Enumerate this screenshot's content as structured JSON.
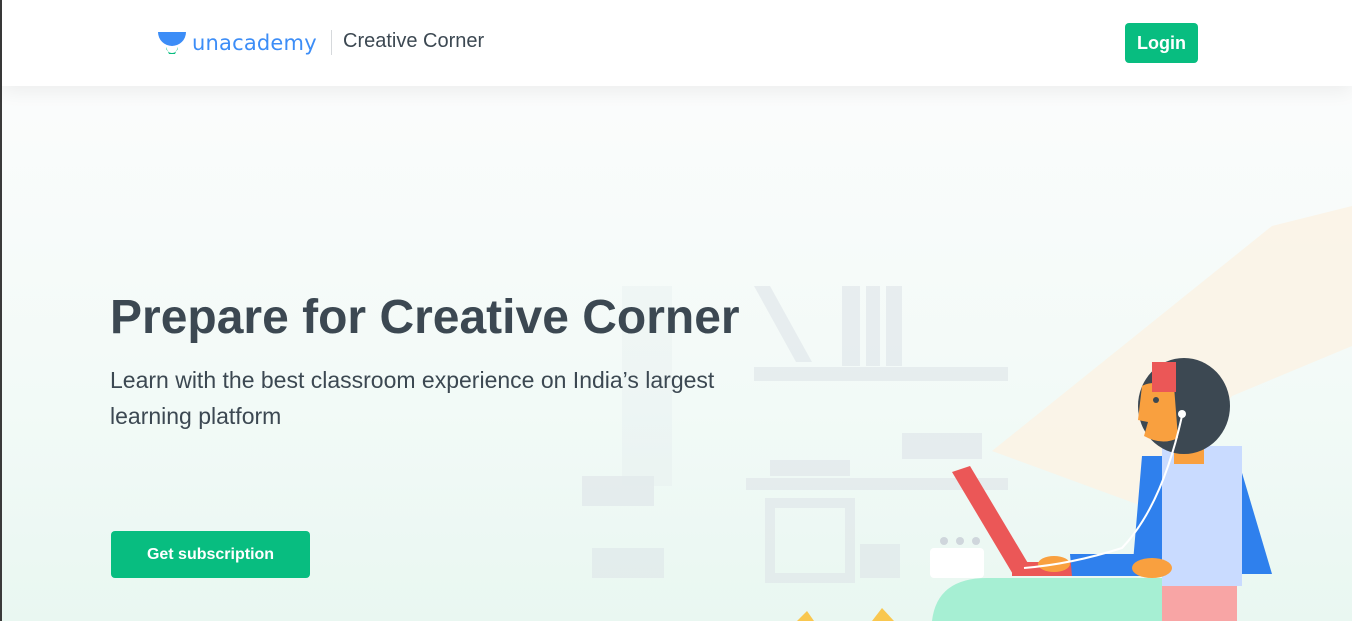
{
  "header": {
    "logo_text": "unacademy",
    "section_title": "Creative Corner",
    "login_label": "Login"
  },
  "hero": {
    "title": "Prepare for Creative Corner",
    "subtitle": "Learn with the best classroom experience on India’s largest learning platform",
    "cta_label": "Get subscription"
  },
  "colors": {
    "brand_green": "#08bd80",
    "brand_blue": "#3c8df7",
    "text_dark": "#3c4852"
  },
  "icons": [
    "unacademy-logo-icon"
  ]
}
